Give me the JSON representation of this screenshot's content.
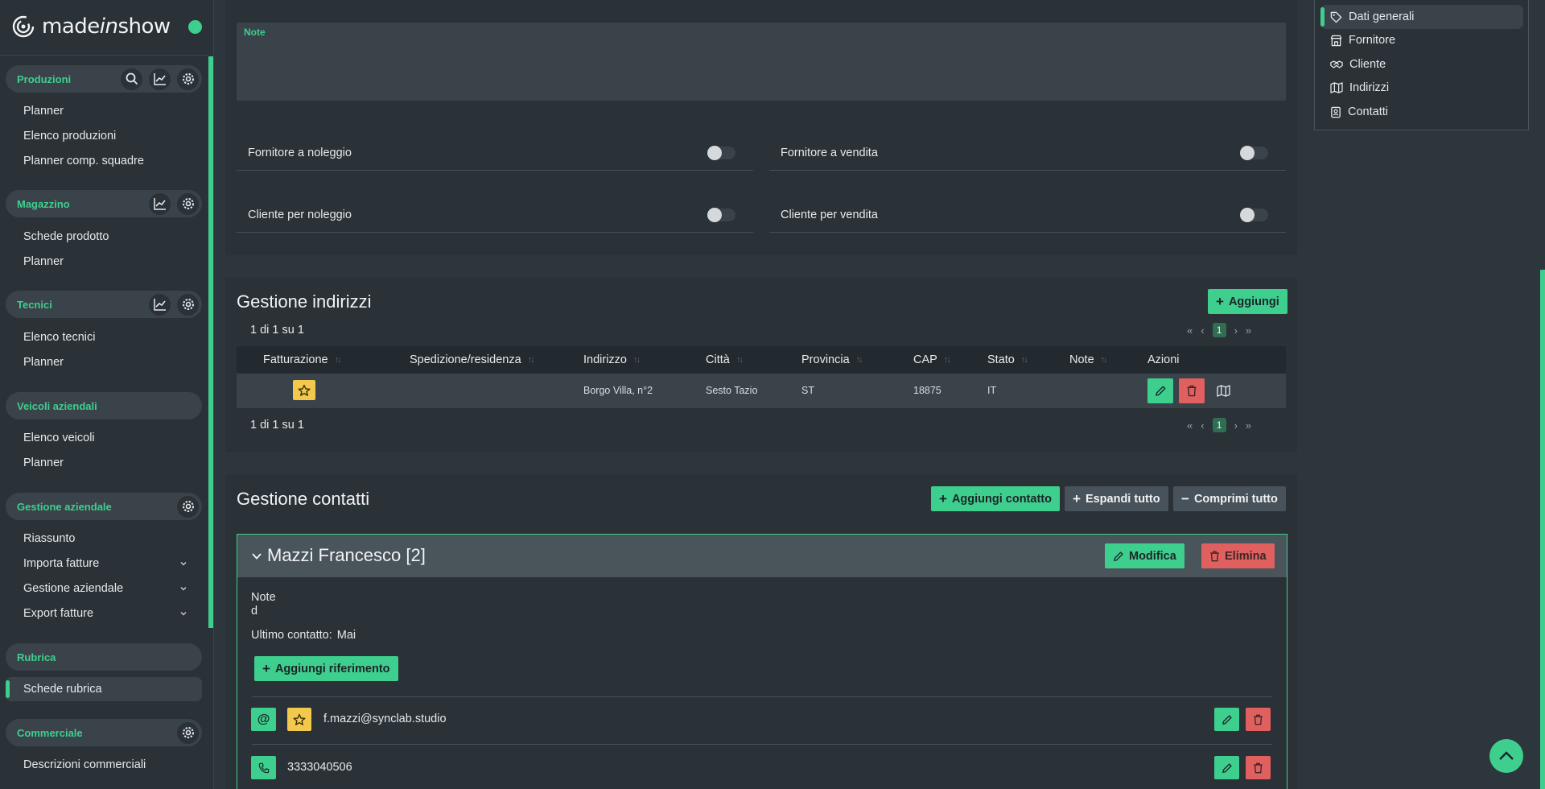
{
  "brand": {
    "name_pre": "made",
    "name_italic": "in",
    "name_post": "show"
  },
  "colors": {
    "accent": "#3ecf8e",
    "danger": "#e0605f",
    "warning": "#f2c94c",
    "bg": "#2e363d",
    "panel": "#2a3137"
  },
  "sidebar": {
    "sections": [
      {
        "label": "Produzioni",
        "icons": [
          "search-icon",
          "chart-icon",
          "gear-icon"
        ],
        "items": [
          "Planner",
          "Elenco produzioni",
          "Planner comp. squadre"
        ]
      },
      {
        "label": "Magazzino",
        "icons": [
          "chart-icon",
          "gear-icon"
        ],
        "items": [
          "Schede prodotto",
          "Planner"
        ]
      },
      {
        "label": "Tecnici",
        "icons": [
          "chart-icon",
          "gear-icon"
        ],
        "items": [
          "Elenco tecnici",
          "Planner"
        ]
      },
      {
        "label": "Veicoli aziendali",
        "icons": [],
        "items": [
          "Elenco veicoli",
          "Planner"
        ]
      },
      {
        "label": "Gestione aziendale",
        "icons": [
          "gear-icon"
        ],
        "items": [
          "Riassunto",
          "Importa fatture",
          "Gestione aziendale",
          "Export fatture"
        ]
      },
      {
        "label": "Rubrica",
        "icons": [],
        "items": [
          "Schede rubrica"
        ]
      },
      {
        "label": "Commerciale",
        "icons": [
          "gear-icon"
        ],
        "items": [
          "Descrizioni commerciali"
        ]
      }
    ]
  },
  "form": {
    "note_label": "Note",
    "toggles": [
      {
        "label": "Fornitore a noleggio",
        "on": false
      },
      {
        "label": "Fornitore a vendita",
        "on": false
      },
      {
        "label": "Cliente per noleggio",
        "on": false
      },
      {
        "label": "Cliente per vendita",
        "on": false
      }
    ]
  },
  "addresses": {
    "title": "Gestione indirizzi",
    "add_label": "Aggiungi",
    "count_text": "1 di 1 su 1",
    "current_page": "1",
    "columns": [
      "Fatturazione",
      "Spedizione/residenza",
      "Indirizzo",
      "Città",
      "Provincia",
      "CAP",
      "Stato",
      "Note",
      "Azioni"
    ],
    "rows": [
      {
        "indirizzo": "Borgo Villa, n°2",
        "citta": "Sesto Tazio",
        "provincia": "ST",
        "cap": "18875",
        "stato": "IT",
        "note": ""
      }
    ]
  },
  "contacts": {
    "title": "Gestione contatti",
    "add_label": "Aggiungi contatto",
    "expand_label": "Espandi tutto",
    "collapse_label": "Comprimi tutto",
    "card": {
      "name": "Mazzi Francesco [2]",
      "edit_label": "Modifica",
      "delete_label": "Elimina",
      "note_label": "Note",
      "note_value": "d",
      "last_contact_label": "Ultimo contatto:",
      "last_contact_value": "Mai",
      "add_ref_label": "Aggiungi riferimento",
      "refs": [
        {
          "type": "email",
          "value": "f.mazzi@synclab.studio"
        },
        {
          "type": "phone",
          "value": "3333040506"
        }
      ]
    }
  },
  "rightnav": {
    "items": [
      {
        "label": "Dati generali",
        "icon": "tag-icon"
      },
      {
        "label": "Fornitore",
        "icon": "store-icon"
      },
      {
        "label": "Cliente",
        "icon": "handshake-icon"
      },
      {
        "label": "Indirizzi",
        "icon": "map-icon"
      },
      {
        "label": "Contatti",
        "icon": "contact-icon"
      }
    ]
  }
}
